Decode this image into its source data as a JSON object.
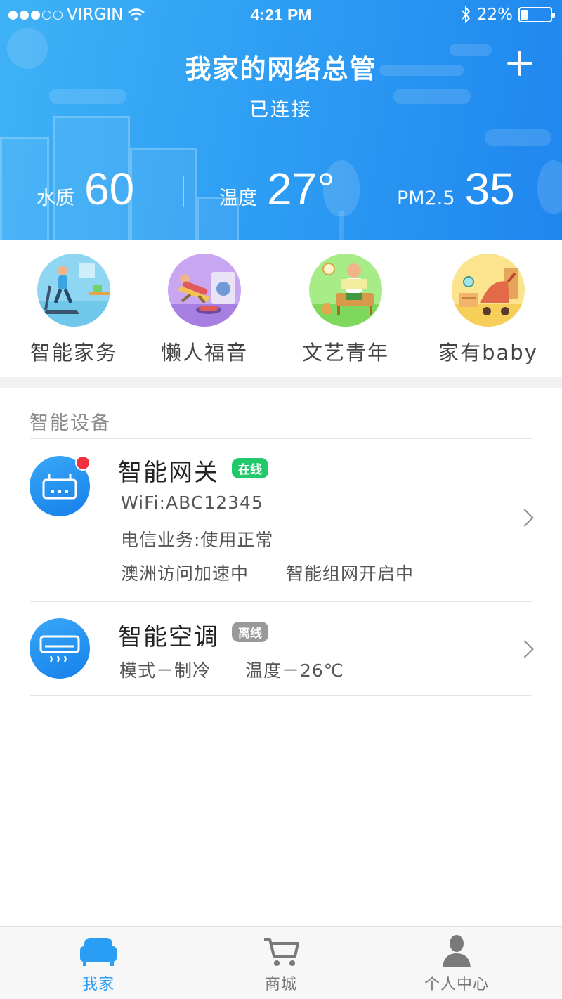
{
  "status_bar": {
    "carrier": "VIRGIN",
    "time": "4:21 PM",
    "battery": "22%",
    "battery_level": 0.22
  },
  "header": {
    "title": "我家的网络总管",
    "subtitle": "已连接",
    "stats": [
      {
        "label": "水质",
        "value": "60"
      },
      {
        "label": "温度",
        "value": "27°"
      },
      {
        "label": "PM2.5",
        "value": "35"
      }
    ]
  },
  "categories": [
    {
      "label": "智能家务",
      "icon": "treadmill-icon"
    },
    {
      "label": "懒人福音",
      "icon": "lounge-chair-icon"
    },
    {
      "label": "文艺青年",
      "icon": "reading-icon"
    },
    {
      "label": "家有baby",
      "icon": "stroller-icon"
    }
  ],
  "devices_section": {
    "title": "智能设备",
    "devices": [
      {
        "name": "智能网关",
        "status": "在线",
        "lines": [
          "WiFi:ABC12345",
          "电信业务:使用正常",
          "澳洲访问加速中",
          "智能组网开启中"
        ]
      },
      {
        "name": "智能空调",
        "status": "离线",
        "lines": [
          "模式－制冷",
          "温度－26℃"
        ]
      }
    ]
  },
  "tabbar": {
    "tabs": [
      {
        "label": "我家",
        "icon": "sofa-icon",
        "active": true
      },
      {
        "label": "商城",
        "icon": "cart-icon",
        "active": false
      },
      {
        "label": "个人中心",
        "icon": "person-icon",
        "active": false
      }
    ]
  },
  "colors": {
    "header_gradient_start": "#3fb2f6",
    "header_gradient_end": "#1f86ee",
    "online_badge": "#22c96a",
    "offline_badge": "#9a9a9a",
    "notification_dot": "#f2303e",
    "active_tab": "#2a9ef4"
  }
}
